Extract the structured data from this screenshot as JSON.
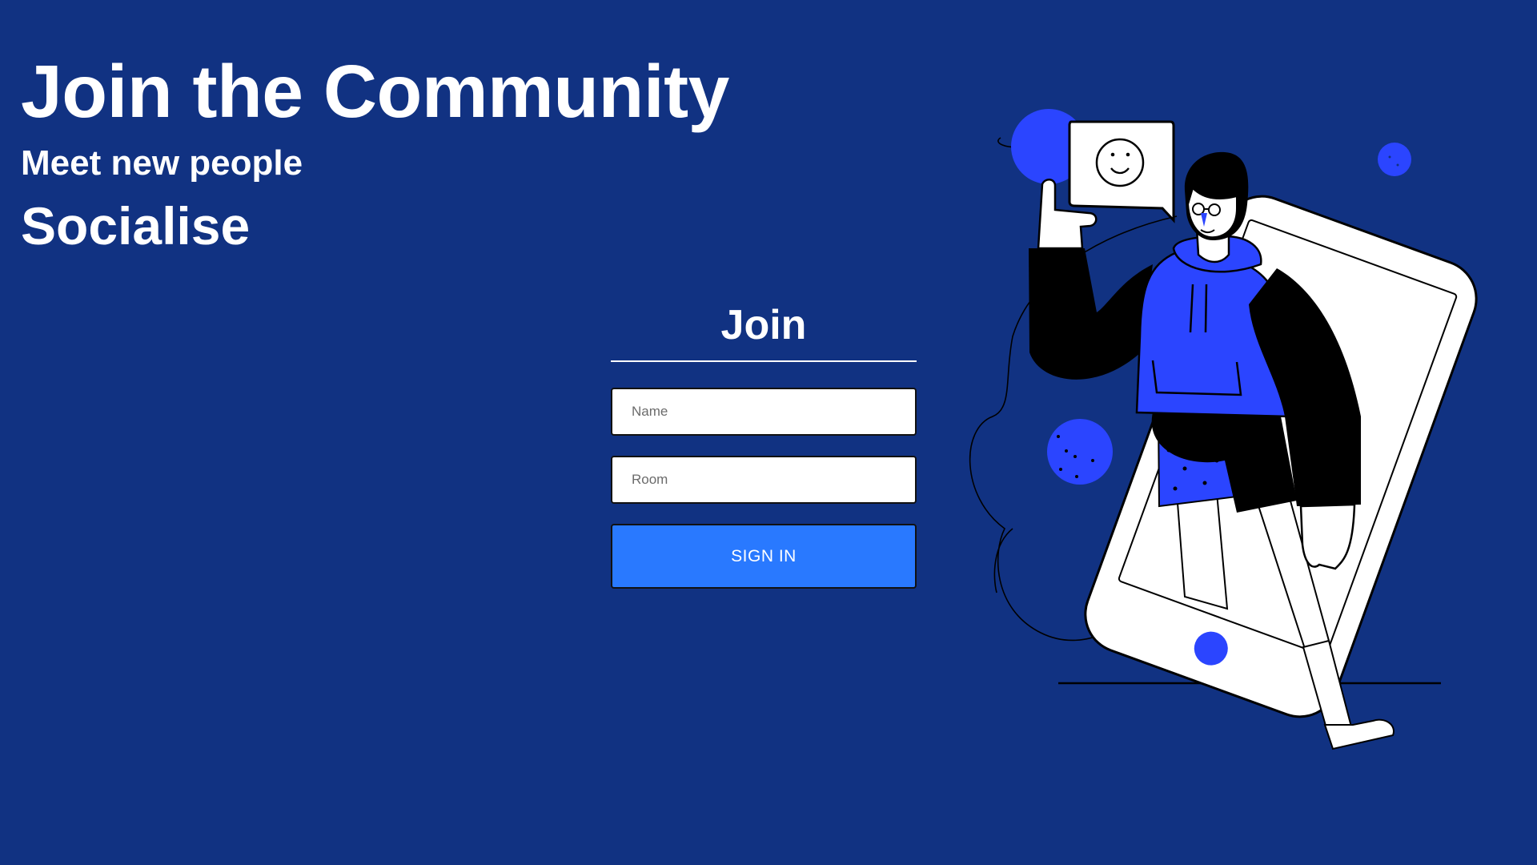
{
  "hero": {
    "title": "Join the Community",
    "subtitle": "Meet new people",
    "tagline": "Socialise"
  },
  "form": {
    "heading": "Join",
    "name_placeholder": "Name",
    "room_placeholder": "Room",
    "submit_label": "SIGN IN"
  },
  "colors": {
    "background": "#113282",
    "button": "#2979ff",
    "accent": "#2b45ff",
    "text": "#ffffff"
  },
  "illustration": {
    "icon": "person-smartphone-chat-illustration"
  }
}
